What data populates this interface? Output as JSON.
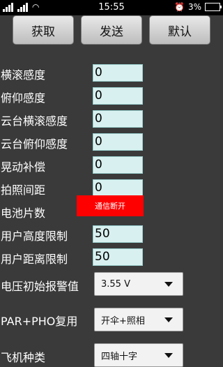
{
  "status": {
    "time": "15:55",
    "battery": "3%"
  },
  "toolbar": {
    "get_label": "获取",
    "send_label": "发送",
    "default_label": "默认"
  },
  "settings": [
    {
      "label": "横滚感度",
      "value": "0"
    },
    {
      "label": "俯仰感度",
      "value": "0"
    },
    {
      "label": "云台横滚感度",
      "value": "0"
    },
    {
      "label": "云台俯仰感度",
      "value": "0"
    },
    {
      "label": "晃动补偿",
      "value": "0"
    },
    {
      "label": "拍照间距",
      "value": "0"
    },
    {
      "label": "电池片数",
      "value": ""
    },
    {
      "label": "用户高度限制",
      "value": "50"
    },
    {
      "label": "用户距离限制",
      "value": "50"
    }
  ],
  "dropdowns": [
    {
      "label": "电压初始报警值",
      "selected": "3.55 V"
    },
    {
      "label": "PAR+PHO复用",
      "selected": "开伞+照相"
    },
    {
      "label": "飞机种类",
      "selected": "四轴十字"
    }
  ],
  "toast": "通信断开",
  "colors": {
    "background": "#3a3a3a",
    "field": "#d8f1f0",
    "toast": "#ff0000"
  }
}
